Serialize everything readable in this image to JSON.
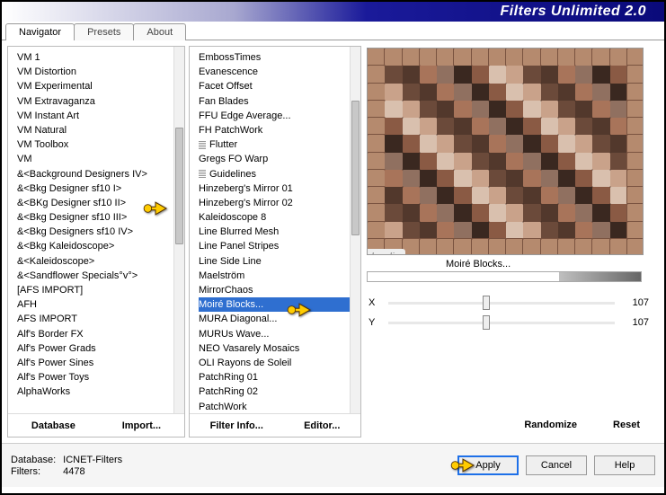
{
  "title": "Filters Unlimited 2.0",
  "tabs": [
    {
      "label": "Navigator",
      "active": true
    },
    {
      "label": "Presets",
      "active": false
    },
    {
      "label": "About",
      "active": false
    }
  ],
  "left_list": {
    "items": [
      "VM 1",
      "VM Distortion",
      "VM Experimental",
      "VM Extravaganza",
      "VM Instant Art",
      "VM Natural",
      "VM Toolbox",
      "VM",
      "&<Background Designers IV>",
      "&<Bkg Designer sf10 I>",
      "&<BKg Designer sf10 II>",
      "&<Bkg Designer sf10 III>",
      "&<Bkg Designers sf10 IV>",
      "&<Bkg Kaleidoscope>",
      "&<Kaleidoscope>",
      "&<Sandflower Specials°v°>",
      "[AFS IMPORT]",
      "AFH",
      "AFS IMPORT",
      "Alf's Border FX",
      "Alf's Power Grads",
      "Alf's Power Sines",
      "Alf's Power Toys",
      "AlphaWorks"
    ],
    "highlight_index": 10,
    "buttons": [
      "Database",
      "Import..."
    ]
  },
  "right_list": {
    "items": [
      "EmbossTimes",
      "Evanescence",
      "Facet Offset",
      "Fan Blades",
      "FFU Edge Average...",
      "FH PatchWork",
      "Flutter",
      "Gregs FO Warp",
      "Guidelines",
      "Hinzeberg's Mirror 01",
      "Hinzeberg's Mirror 02",
      "Kaleidoscope 8",
      "Line Blurred Mesh",
      "Line Panel Stripes",
      "Line Side Line",
      "Maelström",
      "MirrorChaos",
      "Moiré Blocks...",
      "MURA Diagonal...",
      "MURUs Wave...",
      "NEO Vasarely Mosaics",
      "OLI Rayons de Soleil",
      "PatchRing 01",
      "PatchRing 02",
      "PatchWork"
    ],
    "selected_index": 17,
    "ff_indices": [
      6,
      8
    ],
    "buttons": [
      "Filter Info...",
      "Editor..."
    ]
  },
  "preview": {
    "name": "Moiré Blocks...",
    "watermark": "claudia"
  },
  "params": [
    {
      "label": "X",
      "value": 107
    },
    {
      "label": "Y",
      "value": 107
    }
  ],
  "right_footer": [
    "Randomize",
    "Reset"
  ],
  "status": {
    "database_label": "Database:",
    "database_value": "ICNET-Filters",
    "filters_label": "Filters:",
    "filters_value": "4478"
  },
  "buttons": {
    "apply": "Apply",
    "cancel": "Cancel",
    "help": "Help"
  }
}
